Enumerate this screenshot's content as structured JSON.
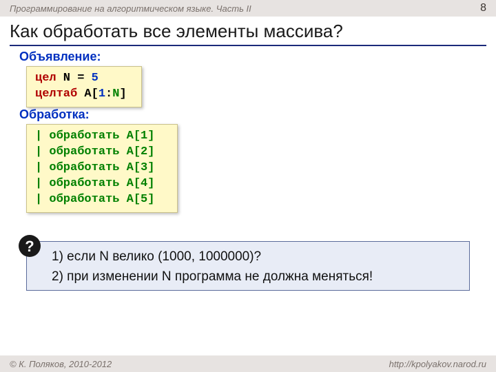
{
  "topbar": {
    "title": "Программирование на алгоритмическом языке. Часть II",
    "page": "8"
  },
  "heading": "Как обработать все элементы массива?",
  "labels": {
    "declaration": "Объявление:",
    "processing": "Обработка:"
  },
  "decl": {
    "kw_int": "цел",
    "var": " N ",
    "eq": "=",
    "five": " 5",
    "kw_arr": "целтаб",
    "arr": " A",
    "lb": "[",
    "one": "1",
    "colon": ":",
    "nvar": "N",
    "rb": "]"
  },
  "proc": {
    "lines": [
      "| обработать A[1]",
      "| обработать A[2]",
      "| обработать A[3]",
      "| обработать A[4]",
      "| обработать A[5]"
    ]
  },
  "question": {
    "mark": "?",
    "line1": "1) если N велико (1000, 1000000)?",
    "line2": "2) при изменении N программа не должна меняться!"
  },
  "footer": {
    "left": "© К. Поляков, 2010-2012",
    "right": "http://kpolyakov.narod.ru"
  }
}
